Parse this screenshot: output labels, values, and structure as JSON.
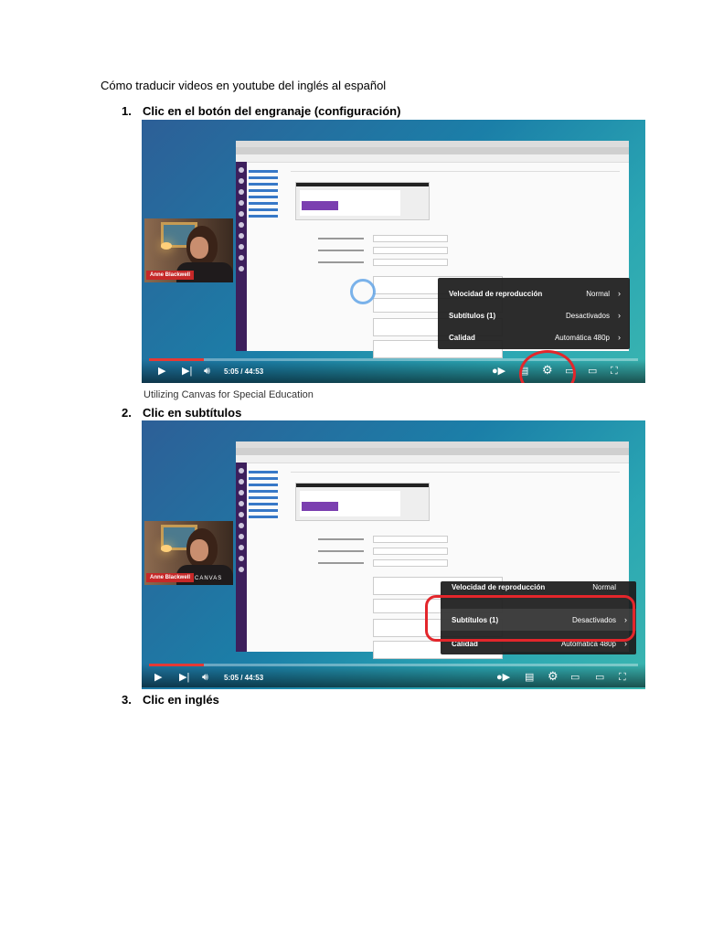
{
  "document": {
    "title": "Cómo traducir videos en youtube del inglés al español",
    "steps": [
      {
        "number": "1.",
        "text": "Clic en el botón del engranaje (configuración)"
      },
      {
        "number": "2.",
        "text": "Clic en subtítulos"
      },
      {
        "number": "3.",
        "text": "Clic en inglés"
      }
    ]
  },
  "screenshot1": {
    "presenter": "Anne Blackwell",
    "menu": [
      {
        "label": "Velocidad de reproducción",
        "value": "Normal"
      },
      {
        "label": "Subtítulos (1)",
        "value": "Desactivados"
      },
      {
        "label": "Calidad",
        "value": "Automática 480p"
      }
    ],
    "time": "5:05 / 44:53",
    "progress_fraction": 0.113,
    "video_title": "Utilizing Canvas for Special Education",
    "highlight_color": "#e3262b"
  },
  "screenshot2": {
    "presenter": "Anne Blackwell",
    "watermark": "CANVAS",
    "menu": [
      {
        "label": "Velocidad de reproducción",
        "value": "Normal"
      },
      {
        "label": "Subtítulos (1)",
        "value": "Desactivados"
      },
      {
        "label": "Calidad",
        "value": "Automática 480p"
      }
    ],
    "time": "5:05 / 44:53",
    "progress_fraction": 0.113,
    "highlight_color": "#e3262b"
  },
  "icons": {
    "play": "play-icon",
    "next": "next-icon",
    "volume": "volume-icon",
    "autoplay": "autoplay-toggle-icon",
    "subtitles": "subtitles-icon",
    "settings": "gear-icon",
    "miniplayer": "miniplayer-icon",
    "theater": "theater-icon",
    "fullscreen": "fullscreen-icon",
    "chevron": "chevron-right-icon"
  }
}
